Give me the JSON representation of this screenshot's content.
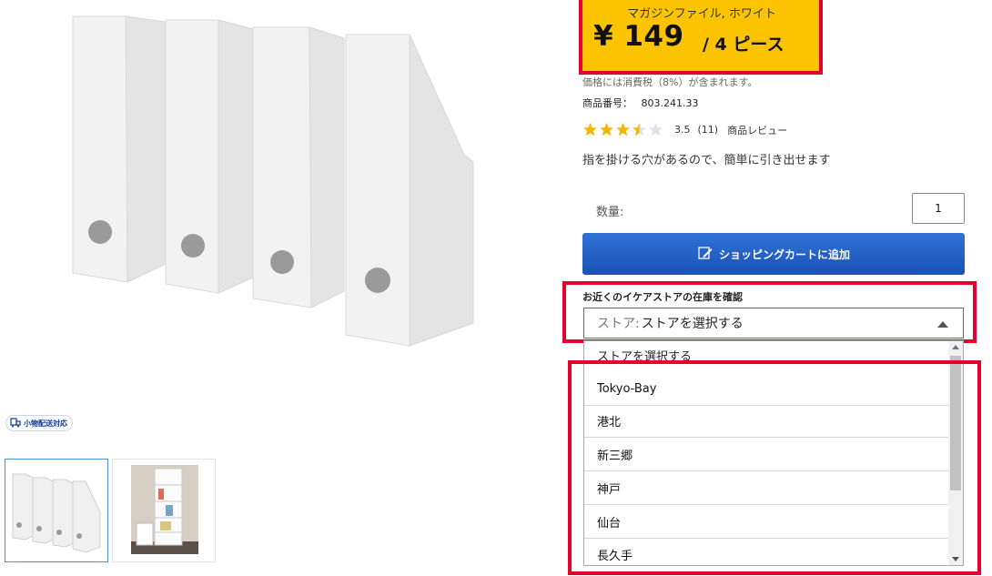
{
  "product": {
    "name": "マガジンファイル, ホワイト",
    "price": "¥ 149",
    "unit": "/ 4 ピース",
    "tax_note": "価格には消費税（8%）が含まれます。",
    "article_label": "商品番号：",
    "article_number": "803.241.33",
    "rating_value": 3.5,
    "rating_text": "3.5",
    "review_count": "(11)",
    "review_link": "商品レビュー",
    "description": "指を掛ける穴があるので、簡単に引き出せます"
  },
  "badge": {
    "label": "小物配送対応",
    "icon": "delivery-icon"
  },
  "thumbnails": [
    {
      "name": "magazine-files-thumbnail",
      "selected": true
    },
    {
      "name": "room-shelf-thumbnail",
      "selected": false
    }
  ],
  "quantity": {
    "label": "数量:",
    "value": "1"
  },
  "cart": {
    "label": "ショッピングカートに追加",
    "icon": "pencil-icon",
    "color": "#1f5fc8"
  },
  "stock": {
    "heading": "お近くのイケアストアの在庫を確認",
    "select_prefix": "ストア:",
    "select_value": "ストアを選択する",
    "options": [
      "ストアを選択する",
      "Tokyo-Bay",
      "港北",
      "新三郷",
      "神戸",
      "仙台",
      "長久手"
    ]
  },
  "colors": {
    "price_bg": "#fcc400",
    "highlight": "#e4002b",
    "button": "#1f5fc8"
  }
}
